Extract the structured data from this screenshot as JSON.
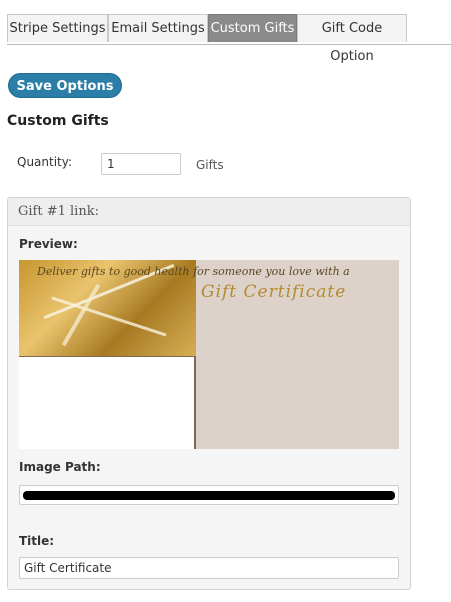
{
  "tabs": [
    {
      "label": "Stripe Settings",
      "active": false
    },
    {
      "label": "Email Settings",
      "active": false
    },
    {
      "label": "Custom Gifts",
      "active": true
    },
    {
      "label": "Gift Code Option",
      "active": false
    }
  ],
  "save_button": {
    "label": "Save Options",
    "color": "#2a7ea8"
  },
  "section": {
    "title": "Custom Gifts"
  },
  "quantity": {
    "label": "Quantity:",
    "value": "1",
    "unit": "Gifts"
  },
  "gift_panel": {
    "header": "Gift #1 link:",
    "preview_label": "Preview:",
    "preview": {
      "tagline": "Deliver gifts to good health for someone you love with a",
      "title": "Gift Certificate"
    },
    "image_path_label": "Image Path:",
    "title_label": "Title:",
    "title_value": "Gift Certificate"
  }
}
